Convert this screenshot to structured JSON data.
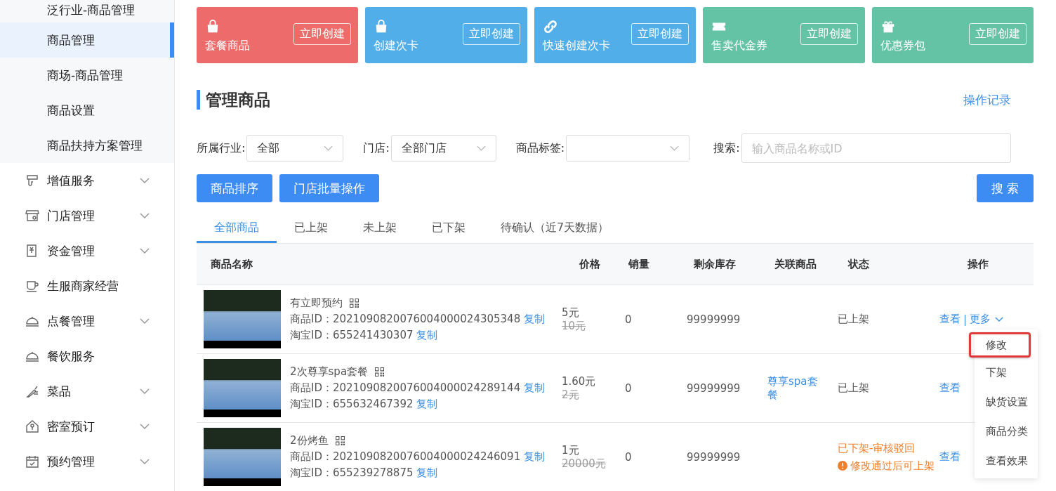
{
  "sidebar": {
    "submenu": [
      {
        "label": "泛行业-商品管理",
        "selected": false
      },
      {
        "label": "商品管理",
        "selected": true
      },
      {
        "label": "商场-商品管理",
        "selected": false
      },
      {
        "label": "商品设置",
        "selected": false
      },
      {
        "label": "商品扶持方案管理",
        "selected": false
      }
    ],
    "items": [
      {
        "label": "增值服务",
        "expandable": true
      },
      {
        "label": "门店管理",
        "expandable": true
      },
      {
        "label": "资金管理",
        "expandable": true
      },
      {
        "label": "生服商家经营",
        "expandable": false
      },
      {
        "label": "点餐管理",
        "expandable": true
      },
      {
        "label": "餐饮服务",
        "expandable": false
      },
      {
        "label": "菜品",
        "expandable": true
      },
      {
        "label": "密室预订",
        "expandable": true
      },
      {
        "label": "预约管理",
        "expandable": true
      }
    ]
  },
  "create_cards": [
    {
      "title": "套餐商品",
      "button": "立即创建",
      "color": "#ee6b6b"
    },
    {
      "title": "创建次卡",
      "button": "立即创建",
      "color": "#51aee9"
    },
    {
      "title": "快速创建次卡",
      "button": "立即创建",
      "color": "#51aee9"
    },
    {
      "title": "售卖代金券",
      "button": "立即创建",
      "color": "#65c3a5"
    },
    {
      "title": "优惠券包",
      "button": "立即创建",
      "color": "#65c3a5"
    }
  ],
  "section": {
    "title": "管理商品",
    "link": "操作记录"
  },
  "filters": [
    {
      "label": "所属行业:",
      "value": "全部",
      "kind": "select"
    },
    {
      "label": "门店:",
      "value": "全部门店",
      "kind": "select"
    },
    {
      "label": "商品标签:",
      "kind": "select"
    },
    {
      "label": "搜索:",
      "placeholder": "输入商品名称或ID",
      "kind": "input"
    }
  ],
  "action_buttons": [
    "商品排序",
    "门店批量操作"
  ],
  "search_button": "搜 索",
  "tabs": [
    {
      "label": "全部商品",
      "selected": true
    },
    {
      "label": "已上架",
      "selected": false
    },
    {
      "label": "未上架",
      "selected": false
    },
    {
      "label": "已下架",
      "selected": false
    },
    {
      "label": "待确认（近7天数据）",
      "selected": false
    }
  ],
  "table": {
    "columns": [
      "商品名称",
      "价格",
      "销量",
      "剩余库存",
      "关联商品",
      "状态",
      "操作"
    ],
    "rows": [
      {
        "name": "有立即预约",
        "product_id_label": "商品ID：",
        "product_id": "2021090820076004000024305348",
        "taobao_id_label": "淘宝ID：",
        "taobao_id": "655241430307",
        "copy_product": "复制",
        "copy_taobao": "复制",
        "price": "5元",
        "original_price": "10元",
        "sales": "0",
        "stock": "99999999",
        "status": "已上架",
        "rejected": false,
        "actions": [
          "查看",
          "更多"
        ],
        "separator": "|"
      },
      {
        "name": "2次尊享spa套餐",
        "product_id_label": "商品ID：",
        "product_id": "2021090820076004000024289144",
        "taobao_id_label": "淘宝ID：",
        "taobao_id": "655632467392",
        "copy_product": "复制",
        "copy_taobao": "复制",
        "price": "1.60元",
        "original_price": "2元",
        "sales": "0",
        "stock": "99999999",
        "related": "尊享spa套餐",
        "status": "已上架",
        "rejected": false,
        "actions": [
          "查看"
        ]
      },
      {
        "name": "2份烤鱼",
        "product_id_label": "商品ID：",
        "product_id": "2021090820076004000024246091",
        "taobao_id_label": "淘宝ID：",
        "taobao_id": "655239278875",
        "copy_product": "复制",
        "copy_taobao": "复制",
        "price": "1元",
        "original_price": "20000元",
        "sales": "0",
        "stock": "99999999",
        "status": "已下架-审核驳回",
        "rejected": true,
        "note": "修改通过后可上架",
        "actions": [
          "查看"
        ]
      }
    ]
  },
  "more_menu": [
    {
      "label": "修改",
      "highlighted": true
    },
    {
      "label": "下架",
      "highlighted": false
    },
    {
      "label": "缺货设置",
      "highlighted": false
    },
    {
      "label": "商品分类",
      "highlighted": false
    },
    {
      "label": "查看效果",
      "highlighted": false
    }
  ]
}
